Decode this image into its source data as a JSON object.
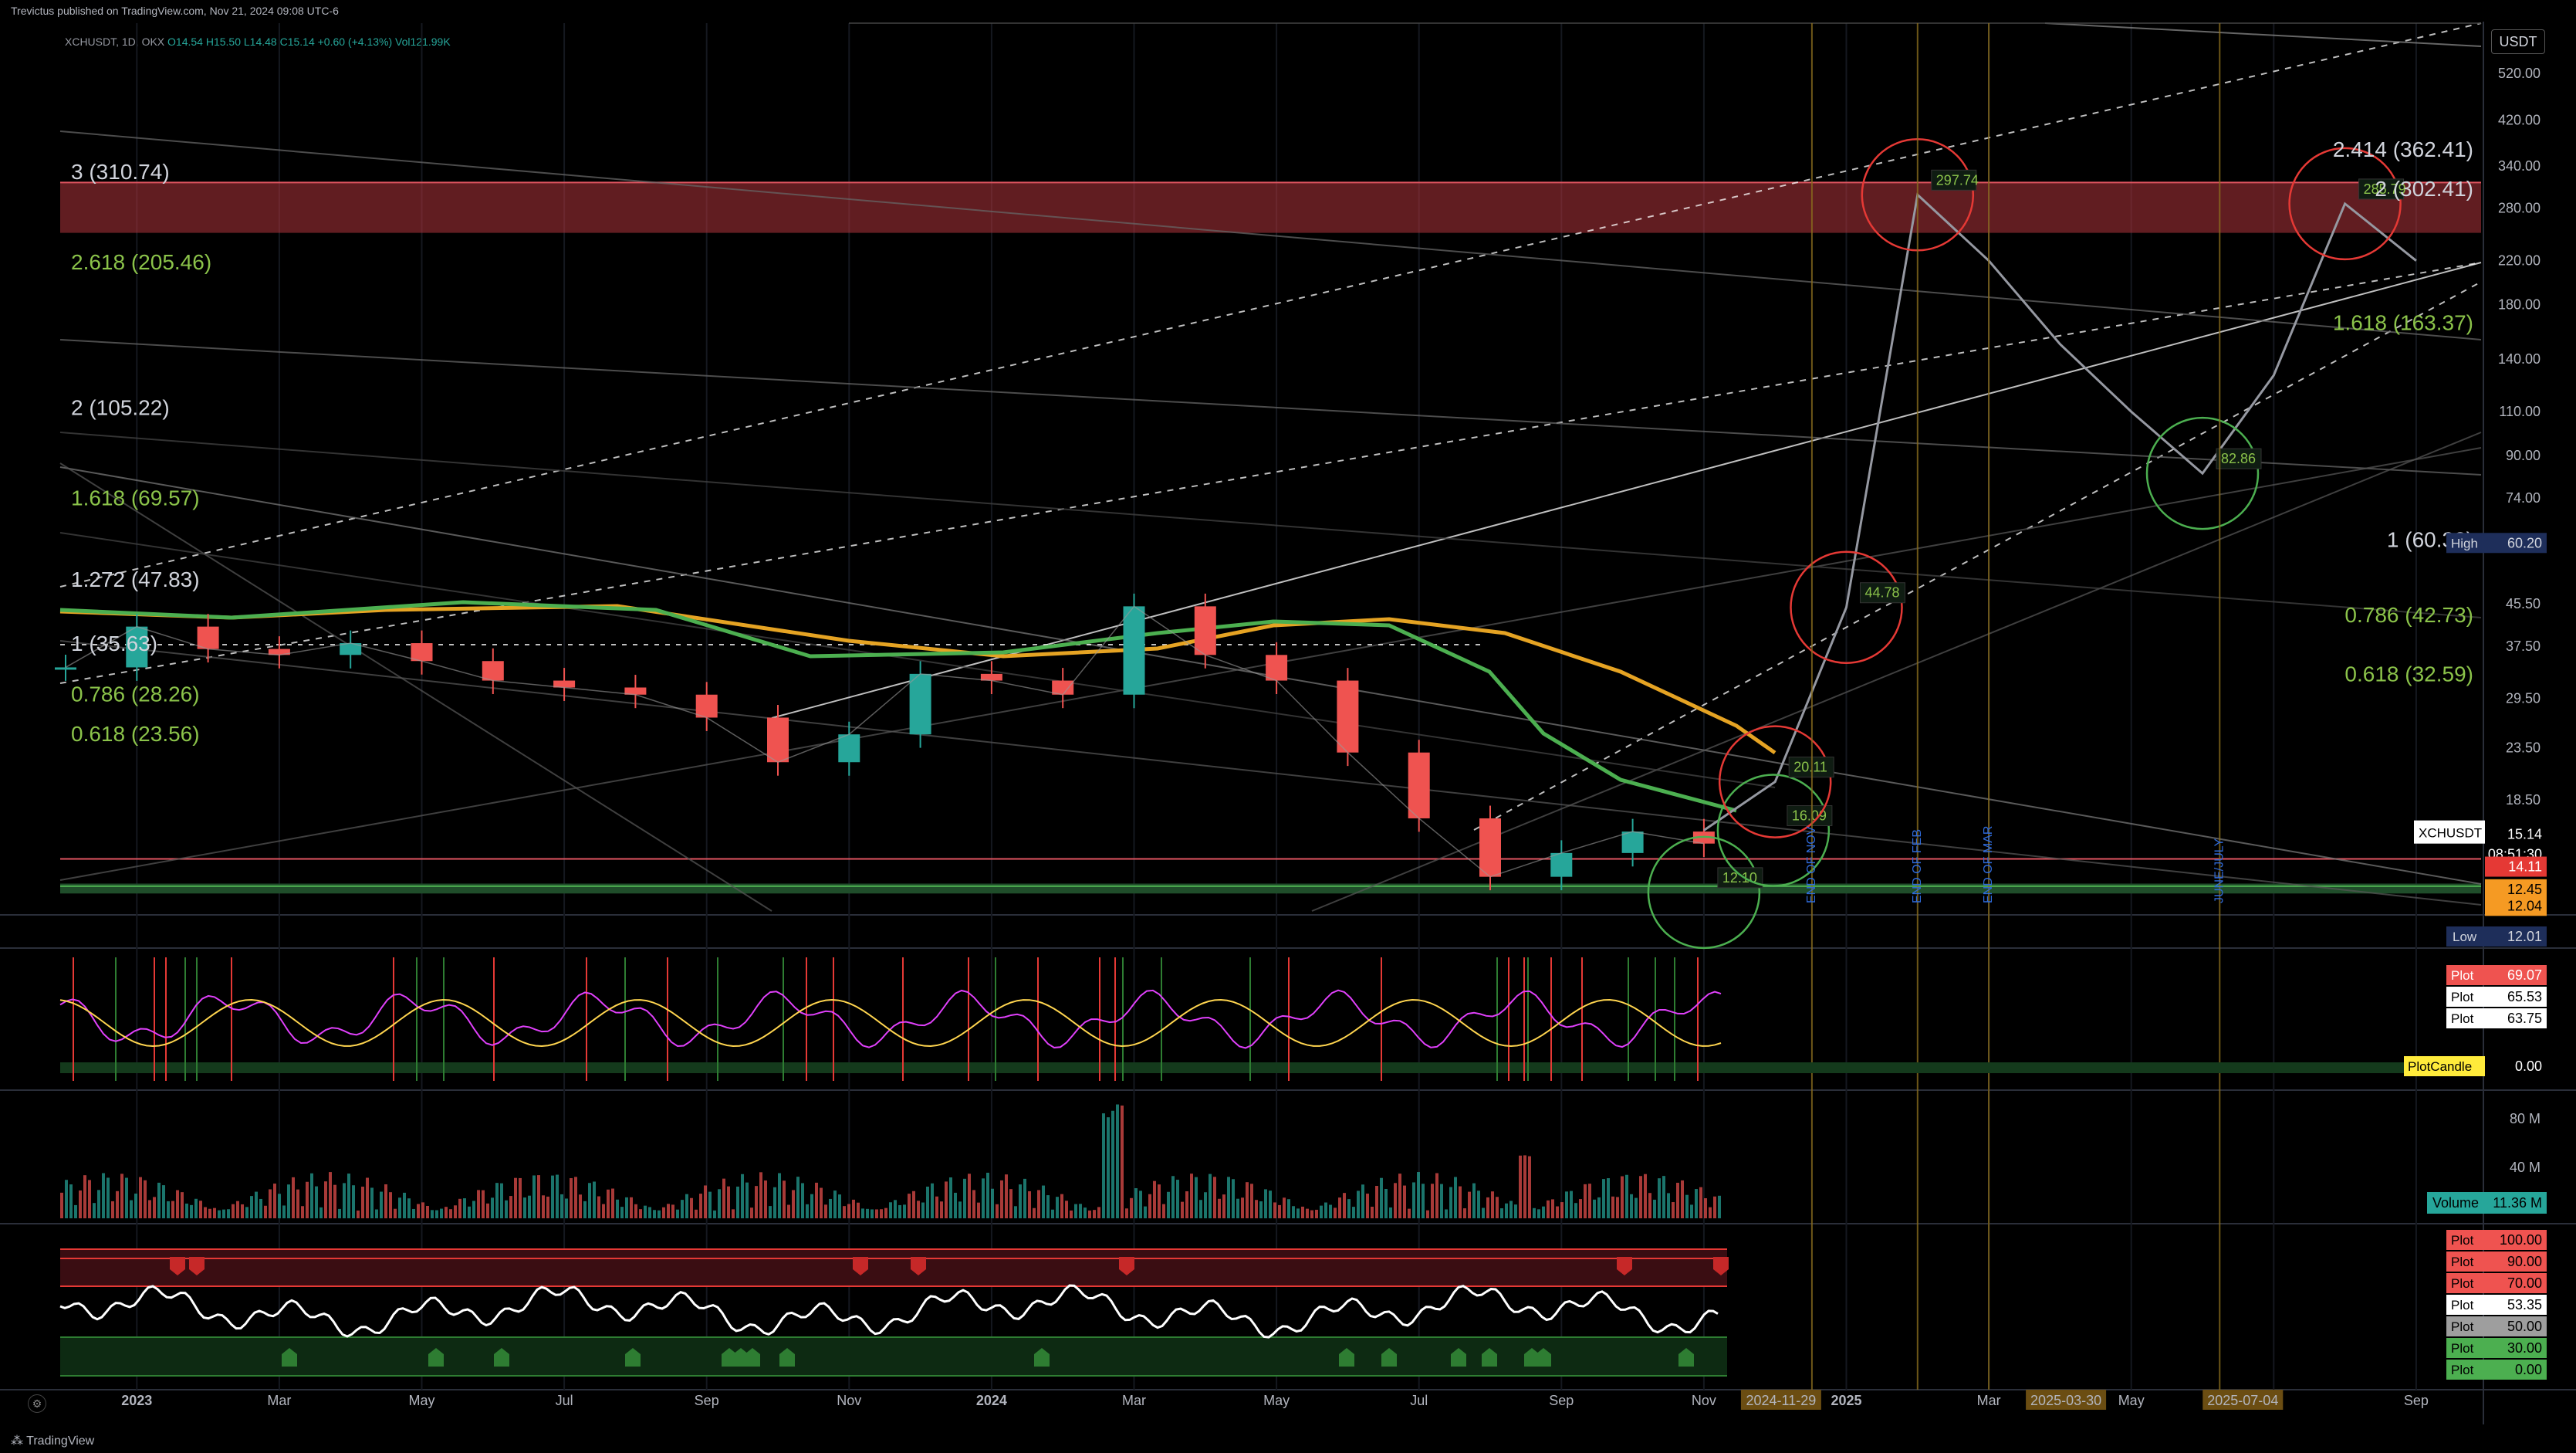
{
  "header": {
    "published": "Trevictus published on TradingView.com, Nov 21, 2024 09:08 UTC-6",
    "symbol_line": "XCHUSDT, 1D, OKX",
    "ohlc": "O14.54 H15.50 L14.48 C15.14 +0.60 (+4.13%)",
    "vol": "Vol121.99K"
  },
  "footer": {
    "brand": "TradingView"
  },
  "colors": {
    "up": "#26a69a",
    "down": "#ef5350",
    "ma_orange": "#e5a323",
    "ma_green": "#4caf50",
    "fib_green": "#8bc34a",
    "zone_red": "#b0343c"
  },
  "chart_data": {
    "type": "line",
    "title": "XCHUSDT",
    "unit": "USDT",
    "price_scale": "log",
    "y_ticks": [
      520,
      420,
      340,
      280,
      220,
      180,
      140,
      110,
      90,
      74,
      60.2,
      45.5,
      37.5,
      29.5,
      23.5,
      18.5,
      15.14,
      14.11,
      12.45,
      12.04
    ],
    "y_ticks_labels": [
      "520.00",
      "420.00",
      "340.00",
      "280.00",
      "220.00",
      "180.00",
      "140.00",
      "110.00",
      "90.00",
      "74.00",
      "60.20",
      "45.50",
      "37.50",
      "29.50",
      "23.50",
      "18.50",
      "15.14",
      "14.11",
      "12.45",
      "12.04"
    ],
    "x_ticks": [
      "2023",
      "Mar",
      "May",
      "Jul",
      "Sep",
      "Nov",
      "2024",
      "Mar",
      "May",
      "Jul",
      "Sep",
      "Nov",
      "2024-11-29",
      "2025",
      "Mar",
      "2025-03-30",
      "May",
      "2025-07-04",
      "Sep"
    ],
    "price_labels": [
      {
        "text": "USDT",
        "kind": "unit"
      },
      {
        "text": "High",
        "value": "60.20",
        "kind": "high"
      },
      {
        "text": "XCHUSDT",
        "value": "15.14",
        "time": "08:51:30",
        "kind": "current"
      },
      {
        "value": "14.11",
        "kind": "red"
      },
      {
        "value": "12.45",
        "kind": "orange"
      },
      {
        "value": "12.04",
        "kind": "orange"
      },
      {
        "text": "Low",
        "value": "12.01",
        "kind": "low"
      }
    ],
    "price_history": [
      {
        "date": "2022-12",
        "close": 34
      },
      {
        "date": "2023-01",
        "close": 41
      },
      {
        "date": "2023-02",
        "close": 37
      },
      {
        "date": "2023-03",
        "close": 36
      },
      {
        "date": "2023-04",
        "close": 38
      },
      {
        "date": "2023-05",
        "close": 35
      },
      {
        "date": "2023-06",
        "close": 32
      },
      {
        "date": "2023-07",
        "close": 31
      },
      {
        "date": "2023-08",
        "close": 30
      },
      {
        "date": "2023-09",
        "close": 27
      },
      {
        "date": "2023-10",
        "close": 22
      },
      {
        "date": "2023-11",
        "close": 25
      },
      {
        "date": "2023-12",
        "close": 33
      },
      {
        "date": "2024-01",
        "close": 32
      },
      {
        "date": "2024-02",
        "close": 30
      },
      {
        "date": "2024-03",
        "close": 45
      },
      {
        "date": "2024-04",
        "close": 36
      },
      {
        "date": "2024-05",
        "close": 32
      },
      {
        "date": "2024-06",
        "close": 23
      },
      {
        "date": "2024-07",
        "close": 17
      },
      {
        "date": "2024-08",
        "close": 13
      },
      {
        "date": "2024-09",
        "close": 14.5
      },
      {
        "date": "2024-10",
        "close": 16
      },
      {
        "date": "2024-11",
        "close": 15.14
      }
    ],
    "projection": [
      {
        "date": "2024-11-29",
        "value": 16.09
      },
      {
        "date": "2024-12",
        "value": 20.11
      },
      {
        "date": "2025-01",
        "value": 44.78
      },
      {
        "date": "2025-02",
        "value": 297.74
      },
      {
        "date": "2025-03",
        "value": 220
      },
      {
        "date": "2025-04",
        "value": 150
      },
      {
        "date": "2025-05",
        "value": 110
      },
      {
        "date": "2025-06",
        "value": 82.86
      },
      {
        "date": "2025-07",
        "value": 130
      },
      {
        "date": "2025-08",
        "value": 285.79
      },
      {
        "date": "2025-09",
        "value": 220
      }
    ],
    "annotations": [
      {
        "text": "12.10"
      },
      {
        "text": "16.09"
      },
      {
        "text": "20.11"
      },
      {
        "text": "44.78"
      },
      {
        "text": "297.74"
      },
      {
        "text": "82.86"
      },
      {
        "text": "285.79"
      },
      {
        "text": "END OF NOV"
      },
      {
        "text": "END OF FEB"
      },
      {
        "text": "END OF MAR"
      },
      {
        "text": "JUNE/JULY"
      }
    ],
    "fib_left": [
      {
        "text": "3 (310.74)"
      },
      {
        "text": "2.618 (205.46)"
      },
      {
        "text": "2 (105.22)"
      },
      {
        "text": "1.618 (69.57)"
      },
      {
        "text": "1.272 (47.83)"
      },
      {
        "text": "1 (35.63)"
      },
      {
        "text": "0.786 (28.26)"
      },
      {
        "text": "0.618 (23.56)"
      }
    ],
    "fib_right": [
      {
        "text": "2.414 (362.41)"
      },
      {
        "text": "2 (302.41)"
      },
      {
        "text": "1.618 (163.37)"
      },
      {
        "text": "1 (60.33)"
      },
      {
        "text": "0.786 (42.73)"
      },
      {
        "text": "0.618 (32.59)"
      }
    ],
    "panes": {
      "oscillator": {
        "labels": [
          {
            "text": "Plot",
            "value": "69.07"
          },
          {
            "text": "Plot",
            "value": "65.53"
          },
          {
            "text": "Plot",
            "value": "63.75"
          },
          {
            "text": "PlotCandle",
            "value": "0.00"
          }
        ]
      },
      "volume": {
        "labels": [
          {
            "text": "11.36 M"
          }
        ],
        "name": "Volume",
        "ticks": [
          "80 M",
          "40 M"
        ]
      },
      "rsi": {
        "labels": [
          {
            "text": "Plot",
            "value": "100.00"
          },
          {
            "text": "Plot",
            "value": "90.00"
          },
          {
            "text": "Plot",
            "value": "70.00"
          },
          {
            "text": "Plot",
            "value": "53.35"
          },
          {
            "text": "Plot",
            "value": "50.00"
          },
          {
            "text": "Plot",
            "value": "30.00"
          },
          {
            "text": "Plot",
            "value": "0.00"
          }
        ]
      }
    }
  }
}
